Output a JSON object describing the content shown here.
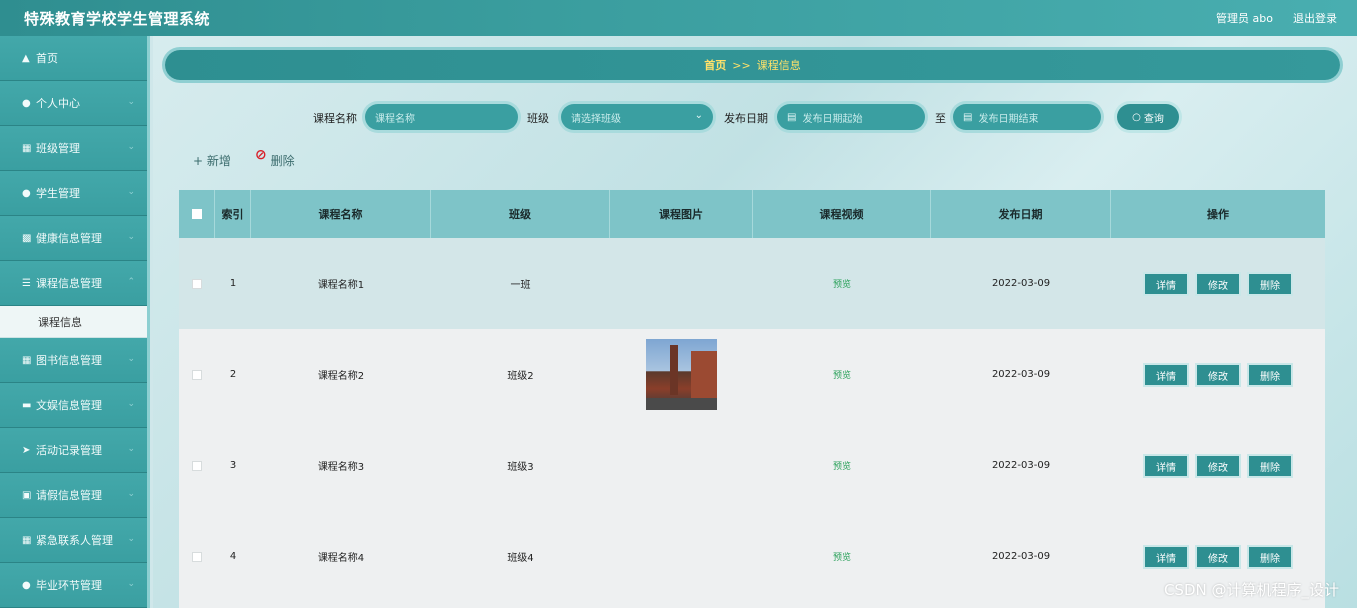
{
  "app": {
    "title": "特殊教育学校学生管理系统",
    "user_label": "管理员 abo",
    "logout_label": "退出登录"
  },
  "sidebar": {
    "items": [
      {
        "icon": "home-icon",
        "label": "首页"
      },
      {
        "icon": "user-icon",
        "label": "个人中心"
      },
      {
        "icon": "grid-icon",
        "label": "班级管理"
      },
      {
        "icon": "user-icon",
        "label": "学生管理"
      },
      {
        "icon": "bar-chart-icon",
        "label": "健康信息管理"
      },
      {
        "icon": "list-icon",
        "label": "课程信息管理"
      },
      {
        "icon": "grid-icon",
        "label": "图书信息管理"
      },
      {
        "icon": "monitor-icon",
        "label": "文娱信息管理"
      },
      {
        "icon": "send-icon",
        "label": "活动记录管理"
      },
      {
        "icon": "ticket-icon",
        "label": "请假信息管理"
      },
      {
        "icon": "grid-icon",
        "label": "紧急联系人管理"
      },
      {
        "icon": "user-icon",
        "label": "毕业环节管理"
      }
    ],
    "sub_item": "课程信息"
  },
  "breadcrumb": {
    "home": "首页",
    "separator": ">>",
    "current": "课程信息"
  },
  "search": {
    "course_name_label": "课程名称",
    "course_name_placeholder": "课程名称",
    "class_label": "班级",
    "class_placeholder": "请选择班级",
    "date_label": "发布日期",
    "date_start_placeholder": "发布日期起始",
    "to_label": "至",
    "date_end_placeholder": "发布日期结束",
    "query_button": "查询"
  },
  "toolbar": {
    "add_label": "新增",
    "delete_label": "删除"
  },
  "table": {
    "headers": {
      "index": "索引",
      "course_name": "课程名称",
      "class": "班级",
      "image": "课程图片",
      "video": "课程视频",
      "date": "发布日期",
      "ops": "操作"
    },
    "rows": [
      {
        "index": "1",
        "course_name": "课程名称1",
        "class": "一班",
        "video": "预览",
        "date": "2022-03-09"
      },
      {
        "index": "2",
        "course_name": "课程名称2",
        "class": "班级2",
        "video": "预览",
        "date": "2022-03-09"
      },
      {
        "index": "3",
        "course_name": "课程名称3",
        "class": "班级3",
        "video": "预览",
        "date": "2022-03-09"
      },
      {
        "index": "4",
        "course_name": "课程名称4",
        "class": "班级4",
        "video": "预览",
        "date": "2022-03-09"
      }
    ],
    "op_detail": "详情",
    "op_edit": "修改",
    "op_delete": "删除"
  },
  "watermark": "CSDN @计算机程序_设计",
  "colors": {
    "primary": "#2e8f91",
    "sidebar": "#3a9fa1",
    "header_row": "#7ec4c8",
    "breadcrumb_text": "#ffe26a",
    "link_green": "#2aa15a",
    "delete_icon": "#d8202a"
  }
}
